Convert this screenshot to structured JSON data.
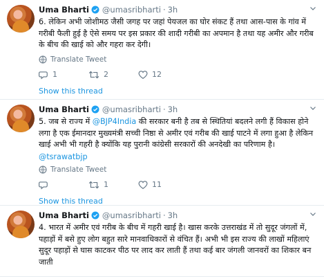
{
  "tweets": [
    {
      "name": "Uma Bharti",
      "handle": "@umasribharti",
      "dot": "·",
      "time": "3h",
      "text": "6. लेकिन अभी जोशीमठ जैसी जगह पर जहां पेयजल का घोर संकट हैं तथा आस-पास के गांव में गरीबी फैली हुई है ऐसे समय पर इस प्रकार की शादी गरीबी का अपमान है तथा यह अमीर और गरीब के बीच की खाई को और गहरा कर देगी।",
      "translate": "Translate Tweet",
      "replies": "1",
      "retweets": "2",
      "likes": "12",
      "show_thread": "Show this thread"
    },
    {
      "name": "Uma Bharti",
      "handle": "@umasribharti",
      "dot": "·",
      "time": "3h",
      "text_pre": "5. जब से राज्य में ",
      "mention": "@BJP4India",
      "text_post": " की सरकार बनी है तब से स्थितियां बदलने लगी हैं विकास होने लगा है एक ईमानदार मुख्यमंत्री सच्ची निष्ठा से अमीर एवं गरीब की खाई पाटने में लगा हुआ है लेकिन खाई अभी भी गहरी है क्योंकि यह पुरानी कांग्रेसी सरकारों की अनदेखी का परिणाम है।",
      "extra_mention": "@tsrawatbjp",
      "translate": "Translate Tweet",
      "replies": "",
      "retweets": "1",
      "likes": "11",
      "show_thread": "Show this thread"
    },
    {
      "name": "Uma Bharti",
      "handle": "@umasribharti",
      "dot": "·",
      "time": "3h",
      "text": "4. भारत में अमीर एवं गरीब के बीच में गहरी खाई है। खास करके उत्तराखंड में तो सुदूर जंगलों में, पहाड़ों में बसे हुए लोग बहुत सारे मानवाधिकारों से वंचित हैं। अभी भी इस राज्य की लाखों महिलाएं सुदूर पहाड़ों से घास काटकर पीठ पर लाद कर लाती हैं तथा कई बार जंगली जानवरों का शिकार बन जाती"
    }
  ],
  "colors": {
    "link": "#1b95e0",
    "muted": "#657786",
    "text": "#14171a"
  },
  "icons": [
    "verified-badge-icon",
    "chevron-down-icon",
    "globe-icon",
    "reply-icon",
    "retweet-icon",
    "like-icon"
  ]
}
